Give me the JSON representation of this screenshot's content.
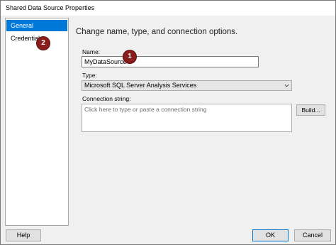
{
  "window": {
    "title": "Shared Data Source Properties"
  },
  "nav": {
    "items": [
      {
        "label": "General",
        "selected": true
      },
      {
        "label": "Credentials",
        "selected": false
      }
    ]
  },
  "main": {
    "heading": "Change name, type, and connection options.",
    "name_label": "Name:",
    "name_value": "MyDataSource",
    "type_label": "Type:",
    "type_value": "Microsoft SQL Server Analysis Services",
    "connection_label": "Connection string:",
    "connection_placeholder": "Click here to type or paste a connection string",
    "build_label": "Build..."
  },
  "footer": {
    "help_label": "Help",
    "ok_label": "OK",
    "cancel_label": "Cancel"
  },
  "callouts": {
    "one": "1",
    "two": "2"
  },
  "colors": {
    "accent": "#0078d7",
    "callout": "#8b1c1c"
  }
}
